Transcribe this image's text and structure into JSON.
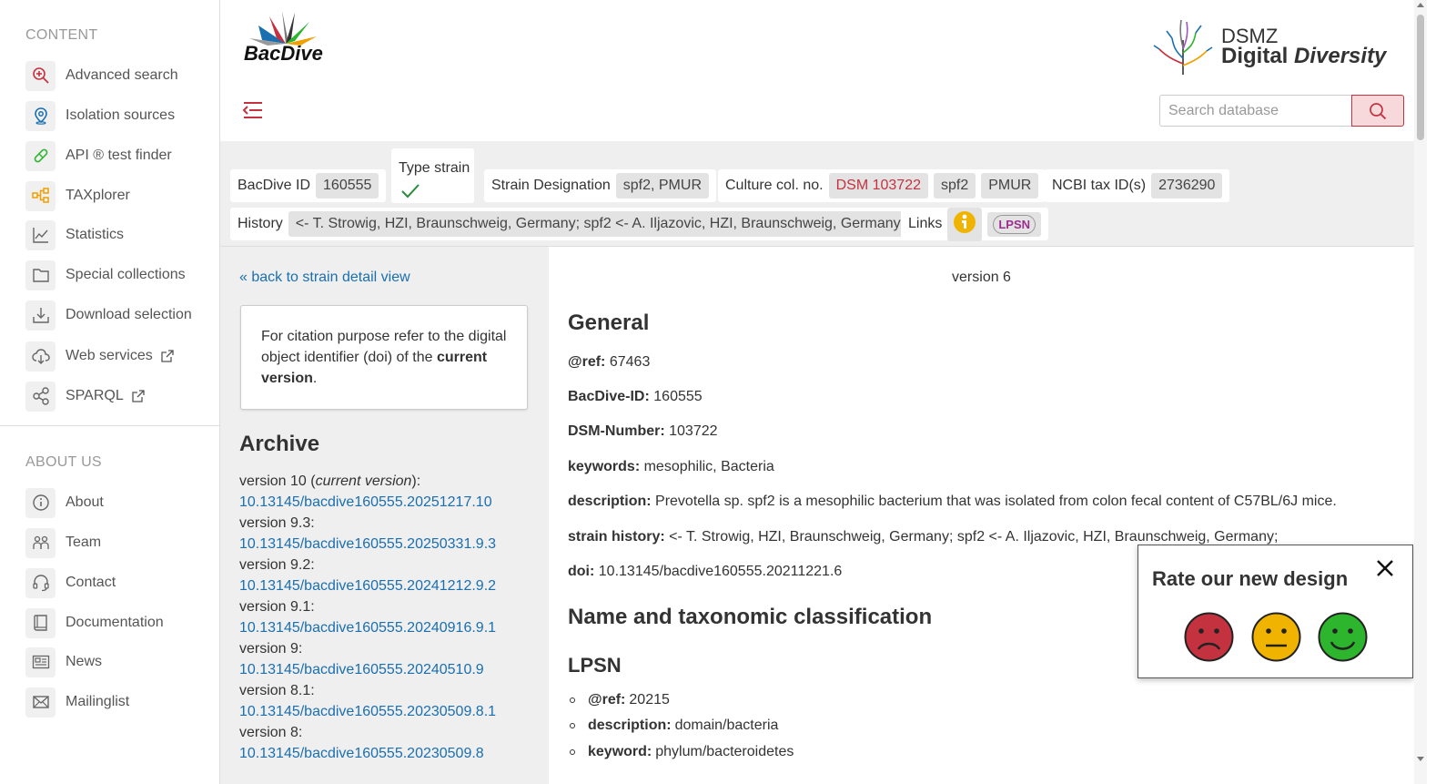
{
  "sidebar": {
    "content_title": "CONTENT",
    "content_items": [
      {
        "label": "Advanced search",
        "icon": "zoom-in-icon"
      },
      {
        "label": "Isolation sources",
        "icon": "location-pin-icon"
      },
      {
        "label": "API ® test finder",
        "icon": "pill-icon"
      },
      {
        "label": "TAXplorer",
        "icon": "tree-icon"
      },
      {
        "label": "Statistics",
        "icon": "line-chart-icon"
      },
      {
        "label": "Special collections",
        "icon": "folder-icon"
      },
      {
        "label": "Download selection",
        "icon": "download-icon"
      },
      {
        "label": "Web services",
        "icon": "cloud-download-icon"
      },
      {
        "label": "SPARQL",
        "icon": "share-icon"
      }
    ],
    "about_title": "ABOUT US",
    "about_items": [
      {
        "label": "About",
        "icon": "info-icon"
      },
      {
        "label": "Team",
        "icon": "team-icon"
      },
      {
        "label": "Contact",
        "icon": "headset-icon"
      },
      {
        "label": "Documentation",
        "icon": "book-icon"
      },
      {
        "label": "News",
        "icon": "newspaper-icon"
      },
      {
        "label": "Mailinglist",
        "icon": "envelope-icon"
      }
    ]
  },
  "header": {
    "logo_text": "BacDive",
    "dsmz_name": "DSMZ",
    "dsmz_sub1": "Digital",
    "dsmz_sub2": "Diversity",
    "search_placeholder": "Search database"
  },
  "infobar": {
    "bacdive_id_label": "BacDive ID",
    "bacdive_id": "160555",
    "type_strain_label": "Type strain",
    "strain_designation_label": "Strain Designation",
    "strain_designation": "spf2, PMUR",
    "culture_label": "Culture col. no.",
    "culture_values": [
      "DSM 103722",
      "spf2",
      "PMUR"
    ],
    "ncbi_label": "NCBI tax ID(s)",
    "ncbi_id": "2736290",
    "history_label": "History",
    "history": "<- T. Strowig, HZI, Braunschweig, Germany; spf2 <- A. Iljazovic, HZI, Braunschweig, Germany;",
    "links_label": "Links",
    "lpsn_label": "LPSN"
  },
  "left": {
    "back_link": "« back to strain detail view",
    "cite_text": "For citation purpose refer to the digital object identifier (doi) of the ",
    "cite_bold": "current version",
    "cite_end": ".",
    "archive_title": "Archive",
    "archive": [
      {
        "version": "version 10 (",
        "note": "current version",
        "suffix": "):",
        "doi": "10.13145/bacdive160555.20251217.10"
      },
      {
        "version": "version 9.3:",
        "note": "",
        "suffix": "",
        "doi": "10.13145/bacdive160555.20250331.9.3"
      },
      {
        "version": "version 9.2:",
        "note": "",
        "suffix": "",
        "doi": "10.13145/bacdive160555.20241212.9.2"
      },
      {
        "version": "version 9.1:",
        "note": "",
        "suffix": "",
        "doi": "10.13145/bacdive160555.20240916.9.1"
      },
      {
        "version": "version 9:",
        "note": "",
        "suffix": "",
        "doi": "10.13145/bacdive160555.20240510.9"
      },
      {
        "version": "version 8.1:",
        "note": "",
        "suffix": "",
        "doi": "10.13145/bacdive160555.20230509.8.1"
      },
      {
        "version": "version 8:",
        "note": "",
        "suffix": "",
        "doi": "10.13145/bacdive160555.20230509.8"
      }
    ]
  },
  "main": {
    "version": "version 6",
    "general_title": "General",
    "fields": [
      {
        "key": "@ref:",
        "value": "67463"
      },
      {
        "key": "BacDive-ID:",
        "value": "160555"
      },
      {
        "key": "DSM-Number:",
        "value": "103722"
      },
      {
        "key": "keywords:",
        "value": "mesophilic, Bacteria"
      },
      {
        "key": "description:",
        "value": "Prevotella sp. spf2 is a mesophilic bacterium that was isolated from colon fecal content of C57BL/6J mice."
      },
      {
        "key": "strain history:",
        "value": "<- T. Strowig, HZI, Braunschweig, Germany; spf2 <- A. Iljazovic, HZI, Braunschweig, Germany;"
      },
      {
        "key": "doi:",
        "value": "10.13145/bacdive160555.20211221.6"
      }
    ],
    "name_title": "Name and taxonomic classification",
    "lpsn_title": "LPSN",
    "lpsn_items": [
      {
        "key": "@ref:",
        "value": "20215"
      },
      {
        "key": "description:",
        "value": "domain/bacteria"
      },
      {
        "key": "keyword:",
        "value": "phylum/bacteroidetes"
      }
    ]
  },
  "rating": {
    "title": "Rate our new design",
    "colors": {
      "bad": "#c5323f",
      "neutral": "#f0b400",
      "good": "#2db52d"
    }
  },
  "colors": {
    "accent": "#c5323f",
    "link": "#1a6fb0"
  }
}
